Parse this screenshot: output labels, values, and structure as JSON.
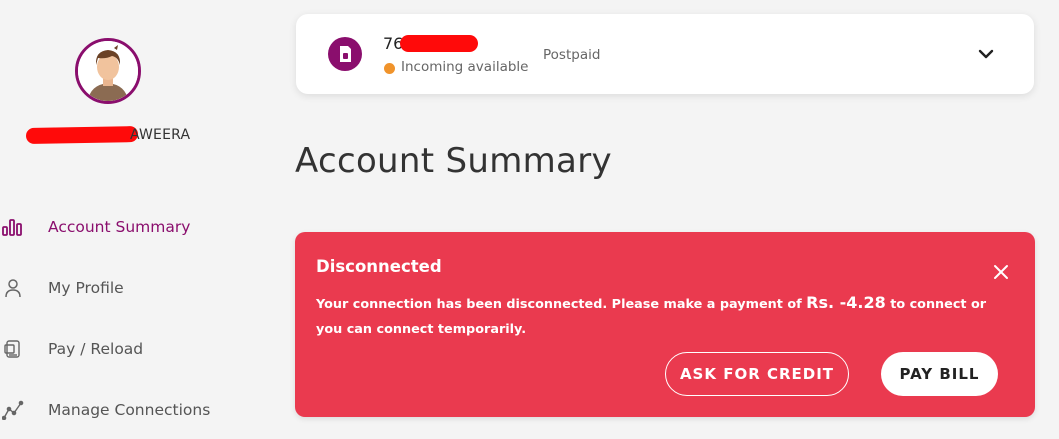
{
  "user": {
    "name_visible": "AWEERA"
  },
  "nav": {
    "items": [
      {
        "label": "Account Summary",
        "icon": "bar-chart-icon",
        "active": true
      },
      {
        "label": "My Profile",
        "icon": "user-icon",
        "active": false
      },
      {
        "label": "Pay / Reload",
        "icon": "wallet-icon",
        "active": false
      },
      {
        "label": "Manage Connections",
        "icon": "connections-icon",
        "active": false
      }
    ]
  },
  "connection": {
    "number_visible": "76",
    "status": "Incoming available",
    "plan": "Postpaid"
  },
  "page": {
    "title": "Account Summary"
  },
  "alert": {
    "title": "Disconnected",
    "message_before": "Your connection has been disconnected. Please make a payment of ",
    "amount": "Rs. -4.28",
    "message_after": " to connect or you can connect temporarily.",
    "ask_credit_label": "ASK FOR CREDIT",
    "pay_bill_label": "PAY BILL"
  },
  "colors": {
    "brand": "#8a0e6d",
    "alert": "#ea3a4f",
    "status_dot": "#f0932b"
  }
}
